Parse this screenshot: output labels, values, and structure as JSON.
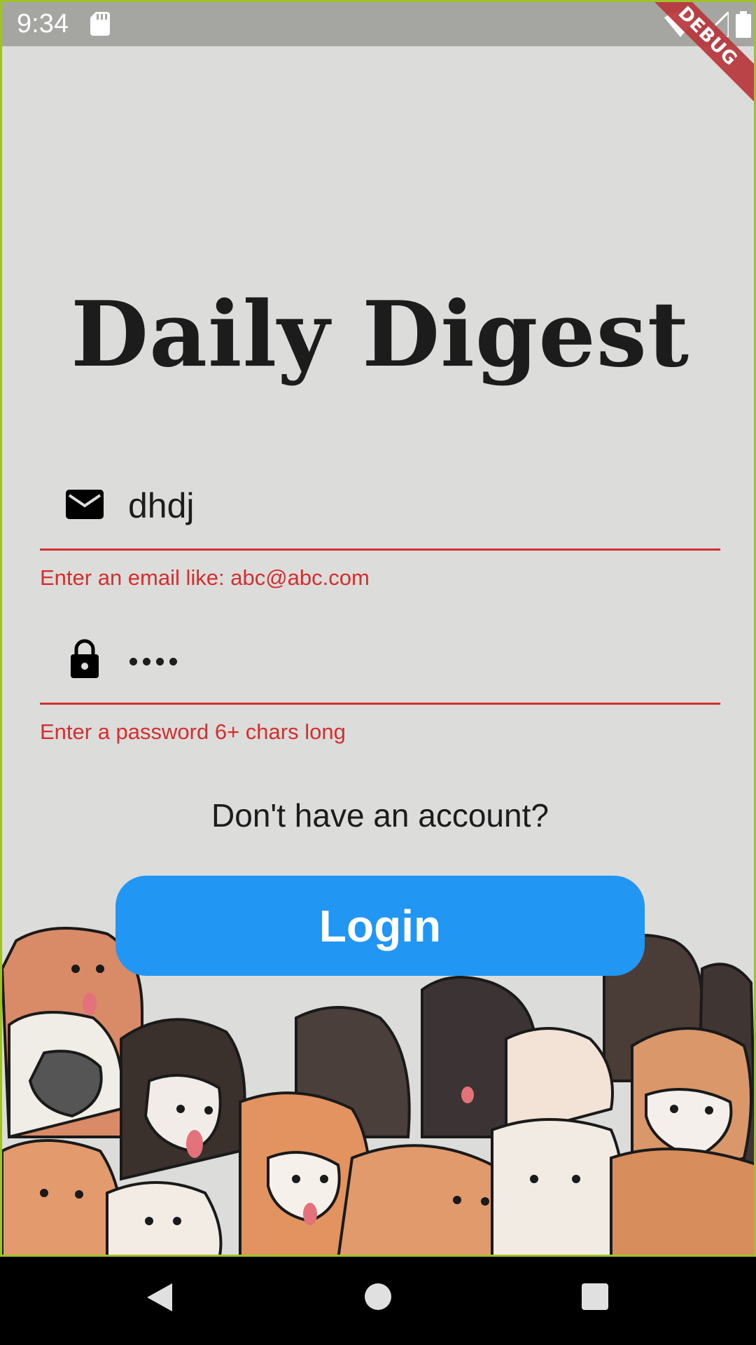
{
  "status_bar": {
    "time": "9:34",
    "icons": [
      "sd-card-icon",
      "wifi-icon",
      "signal-icon",
      "battery-icon"
    ],
    "debug_label": "DEBUG"
  },
  "app": {
    "title": "Daily Digest"
  },
  "email_field": {
    "icon": "mail-icon",
    "value": "dhdj",
    "error": "Enter an email like: abc@abc.com"
  },
  "password_field": {
    "icon": "lock-icon",
    "masked_length": 4,
    "error": "Enter a password 6+ chars long"
  },
  "signup_link": "Don't have an account?",
  "login_button": "Login",
  "colors": {
    "background": "#dcdcda",
    "accent": "#2196f3",
    "error": "#d32f2f",
    "title": "#1c1c1c"
  },
  "navigation_bar": {
    "buttons": [
      "back-icon",
      "home-icon",
      "recents-icon"
    ]
  }
}
